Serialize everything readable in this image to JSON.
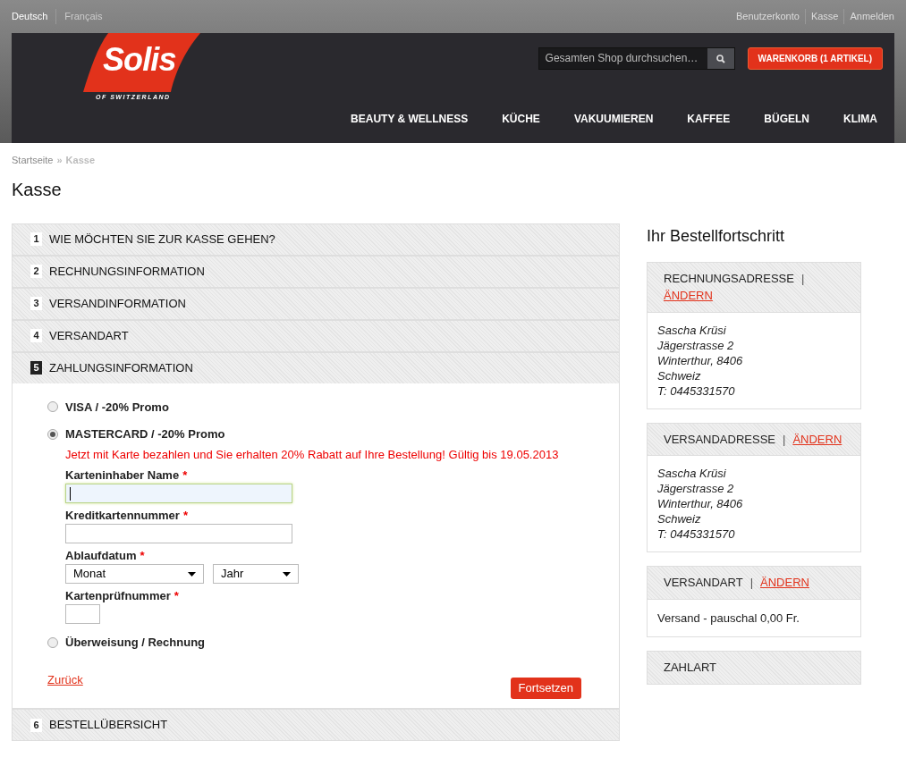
{
  "languages": [
    {
      "label": "Deutsch",
      "selected": true
    },
    {
      "label": "Français",
      "selected": false
    }
  ],
  "account_links": [
    "Benutzerkonto",
    "Kasse",
    "Anmelden"
  ],
  "logo": {
    "wordmark": "Solis",
    "tagline": "OF SWITZERLAND"
  },
  "search": {
    "placeholder": "Gesamten Shop durchsuchen…"
  },
  "cart_button": "WARENKORB (1 ARTIKEL)",
  "nav": [
    "BEAUTY & WELLNESS",
    "KÜCHE",
    "VAKUUMIEREN",
    "KAFFEE",
    "BÜGELN",
    "KLIMA"
  ],
  "breadcrumb": [
    {
      "label": "Startseite",
      "current": false
    },
    {
      "label": "»",
      "current": true
    },
    {
      "label": "Kasse",
      "current": true
    }
  ],
  "page_title": "Kasse",
  "steps": [
    {
      "number": "1",
      "title": "WIE MÖCHTEN SIE ZUR KASSE GEHEN?",
      "selected": false
    },
    {
      "number": "2",
      "title": "RECHNUNGSINFORMATION",
      "selected": false
    },
    {
      "number": "3",
      "title": "VERSANDINFORMATION",
      "selected": false
    },
    {
      "number": "4",
      "title": "VERSANDART",
      "selected": false
    },
    {
      "number": "5",
      "title": "ZAHLUNGSINFORMATION",
      "selected": true
    },
    {
      "number": "6",
      "title": "BESTELLÜBERSICHT",
      "selected": false
    }
  ],
  "payment_methods": [
    {
      "label": "VISA / -20% Promo",
      "selected": false
    },
    {
      "label": "MASTERCARD / -20% Promo",
      "selected": true,
      "promo": "Jetzt mit Karte bezahlen und Sie erhalten 20% Rabatt auf Ihre Bestellung! Gültig bis 19.05.2013",
      "fields": [
        {
          "kind": "text",
          "label": "Karteninhaber Name",
          "required": "*",
          "focused": true
        },
        {
          "kind": "text",
          "label": "Kreditkartennummer",
          "required": "*",
          "focused": false
        },
        {
          "kind": "selects",
          "label": "Ablaufdatum",
          "required": "*",
          "selects": [
            "Monat",
            "Jahr"
          ]
        },
        {
          "kind": "short",
          "label": "Kartenprüfnummer",
          "required": "*",
          "focused": false
        }
      ]
    },
    {
      "label": "Überweisung / Rechnung",
      "selected": false
    }
  ],
  "back_link": "Zurück",
  "continue_button": "Fortsetzen",
  "progress": {
    "title": "Ihr Bestellfortschritt",
    "blocks": [
      {
        "title": "RECHNUNGSADRESSE",
        "separator": "|",
        "change": "ÄNDERN",
        "kind": "address",
        "lines": [
          "Sascha Krüsi",
          "Jägerstrasse 2",
          "Winterthur, 8406",
          "Schweiz",
          "T: 0445331570"
        ]
      },
      {
        "title": "VERSANDADRESSE",
        "separator": "|",
        "change": "ÄNDERN",
        "kind": "address",
        "lines": [
          "Sascha Krüsi",
          "Jägerstrasse 2",
          "Winterthur, 8406",
          "Schweiz",
          "T: 0445331570"
        ]
      },
      {
        "title": "VERSANDART",
        "separator": "|",
        "change": "ÄNDERN",
        "kind": "text",
        "lines": [
          "Versand - pauschal 0,00 Fr."
        ]
      },
      {
        "title": "ZAHLART",
        "kind": "none"
      }
    ]
  }
}
